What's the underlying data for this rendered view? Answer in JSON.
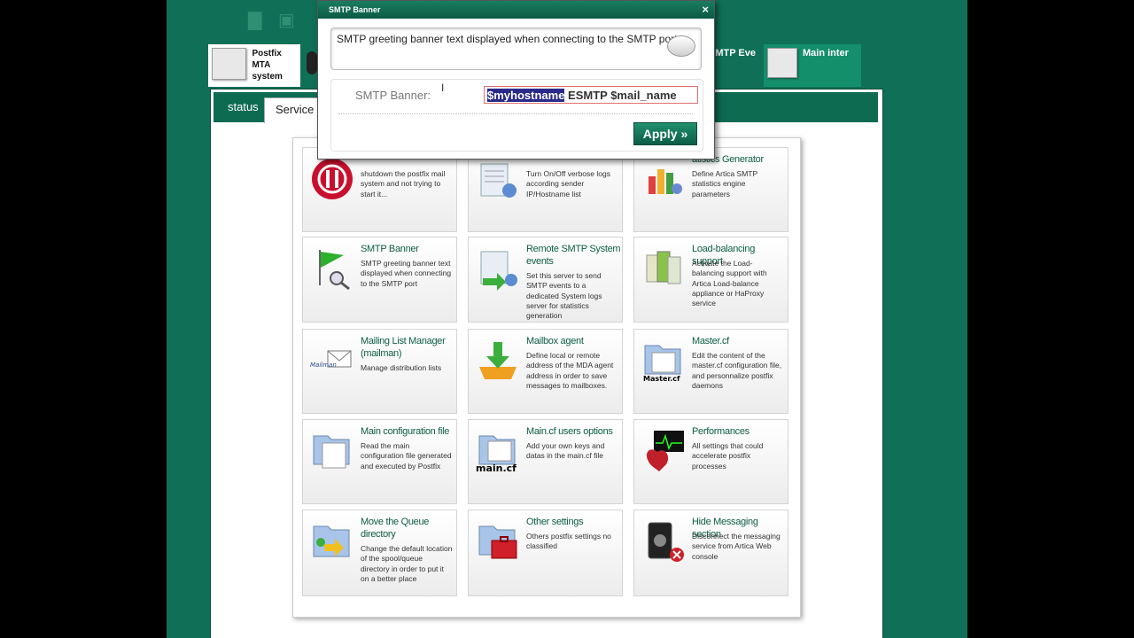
{
  "tabs": {
    "postfix": "Postfix MTA system",
    "smtp_events": "SMTP Eve",
    "main_interface": "Main inter"
  },
  "panel_tabs": {
    "status": "status",
    "service": "Service"
  },
  "dialog": {
    "title": "SMTP Banner",
    "close": "×",
    "description": "SMTP greeting banner text displayed when connecting to the SMTP port",
    "label": "SMTP Banner:",
    "value_selected": "$myhostname",
    "value_rest": " ESMTP $mail_name",
    "apply": "Apply »"
  },
  "cards": [
    {
      "title": "",
      "desc": "shutdown the postfix mail system and not trying to start it..."
    },
    {
      "title": "",
      "desc": "Turn On/Off verbose logs according sender IP/Hostname list"
    },
    {
      "title": "atistics Generator",
      "desc": "Define Artica SMTP statistics engine parameters"
    },
    {
      "title": "SMTP Banner",
      "desc": "SMTP greeting banner text displayed when connecting to the SMTP port"
    },
    {
      "title": "Remote SMTP System events",
      "desc": "Set this server to send SMTP events to a dedicated System logs server for statistics generation"
    },
    {
      "title": "Load-balancing support",
      "desc": "Activate the Load-balancing support with Artica Load-balance appliance or HaProxy service"
    },
    {
      "title": "Mailing List Manager (mailman)",
      "desc": "Manage distribution lists"
    },
    {
      "title": "Mailbox agent",
      "desc": "Define local or remote address of the MDA agent address in order to save messages to mailboxes."
    },
    {
      "title": "Master.cf",
      "desc": "Edit the content of the master.cf configuration file, and personnalize postfix daemons"
    },
    {
      "title": "Main configuration file",
      "desc": "Read the main configuration file generated and executed by Postfix"
    },
    {
      "title": "Main.cf users options",
      "desc": "Add your own keys and datas in the main.cf file"
    },
    {
      "title": "Performances",
      "desc": "All settings that could accelerate postfix processes"
    },
    {
      "title": "Move the Queue directory",
      "desc": "Change the default location of the spool/queue directory in order to put it on a better place"
    },
    {
      "title": "Other settings",
      "desc": "Others postfix settings no classified"
    },
    {
      "title": "Hide Messaging section",
      "desc": "Disconnect the messaging service from Artica Web console"
    }
  ],
  "icon_labels": {
    "mailman": "Mailman",
    "master": "Master.cf",
    "maincf": "main.cf"
  }
}
